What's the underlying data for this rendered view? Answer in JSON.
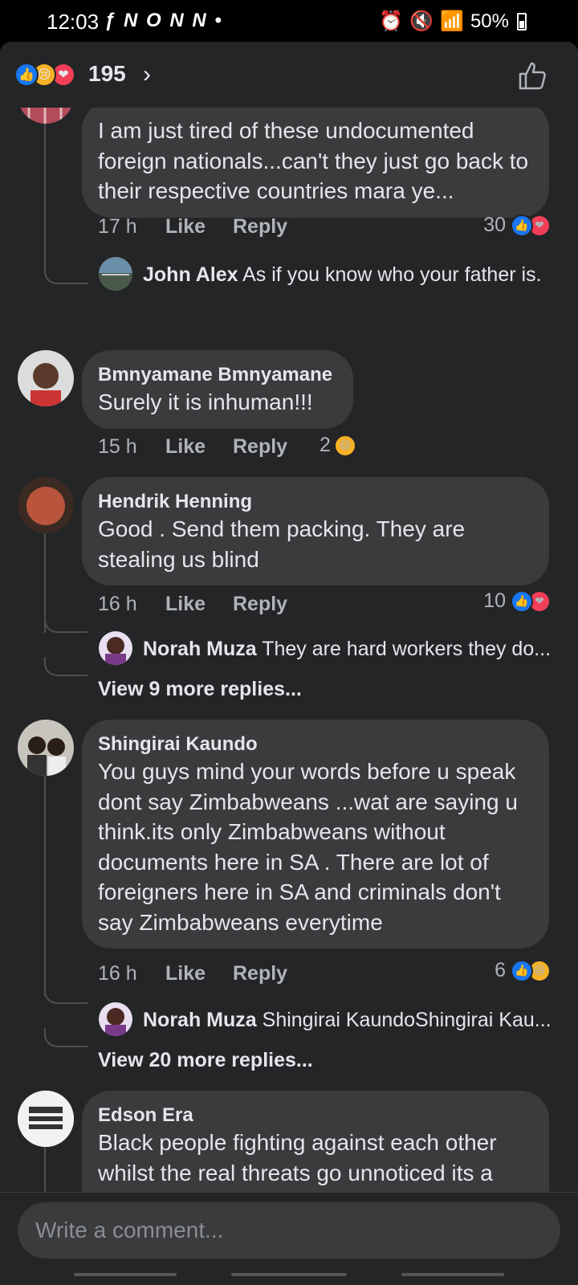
{
  "status": {
    "time": "12:03",
    "apps": "ƒ N O N N •",
    "battery": "50%"
  },
  "header": {
    "reaction_count": "195"
  },
  "comments": [
    {
      "name": "",
      "text": "I am just tired of these undocumented foreign nationals...can't they just go back to their respective countries mara ye...",
      "time": "17 h",
      "like": "Like",
      "reply": "Reply",
      "reactions": "30",
      "replies": [
        {
          "name": "John Alex",
          "text": "As if you know who your father is."
        }
      ]
    },
    {
      "name": "Bmnyamane Bmnyamane",
      "text": "Surely it is inhuman!!!",
      "time": "15 h",
      "like": "Like",
      "reply": "Reply",
      "reactions": "2"
    },
    {
      "name": "Hendrik Henning",
      "text": "Good . Send them packing. They are stealing us blind",
      "time": "16 h",
      "like": "Like",
      "reply": "Reply",
      "reactions": "10",
      "replies": [
        {
          "name": "Norah Muza",
          "text": "They are hard workers they do..."
        }
      ],
      "view_more": "View 9 more replies..."
    },
    {
      "name": "Shingirai Kaundo",
      "text": "You guys mind your words before u speak dont say Zimbabweans ...wat are saying u think.its only Zimbabweans without documents here in SA . There are lot of foreigners here in SA and criminals don't say Zimbabweans everytime",
      "time": "16 h",
      "like": "Like",
      "reply": "Reply",
      "reactions": "6",
      "replies": [
        {
          "name": "Norah Muza",
          "text": "Shingirai KaundoShingirai Kau..."
        }
      ],
      "view_more": "View 20 more replies..."
    },
    {
      "name": "Edson Era",
      "text": "Black people fighting against each other whilst the real threats go unnoticed its a shame"
    }
  ],
  "composer": {
    "placeholder": "Write a comment..."
  },
  "colors": {
    "background": "#242526",
    "bubble": "#3a3b3c",
    "like_blue": "#1877f2",
    "love_red": "#f33e58",
    "haha_yellow": "#f7b125"
  }
}
